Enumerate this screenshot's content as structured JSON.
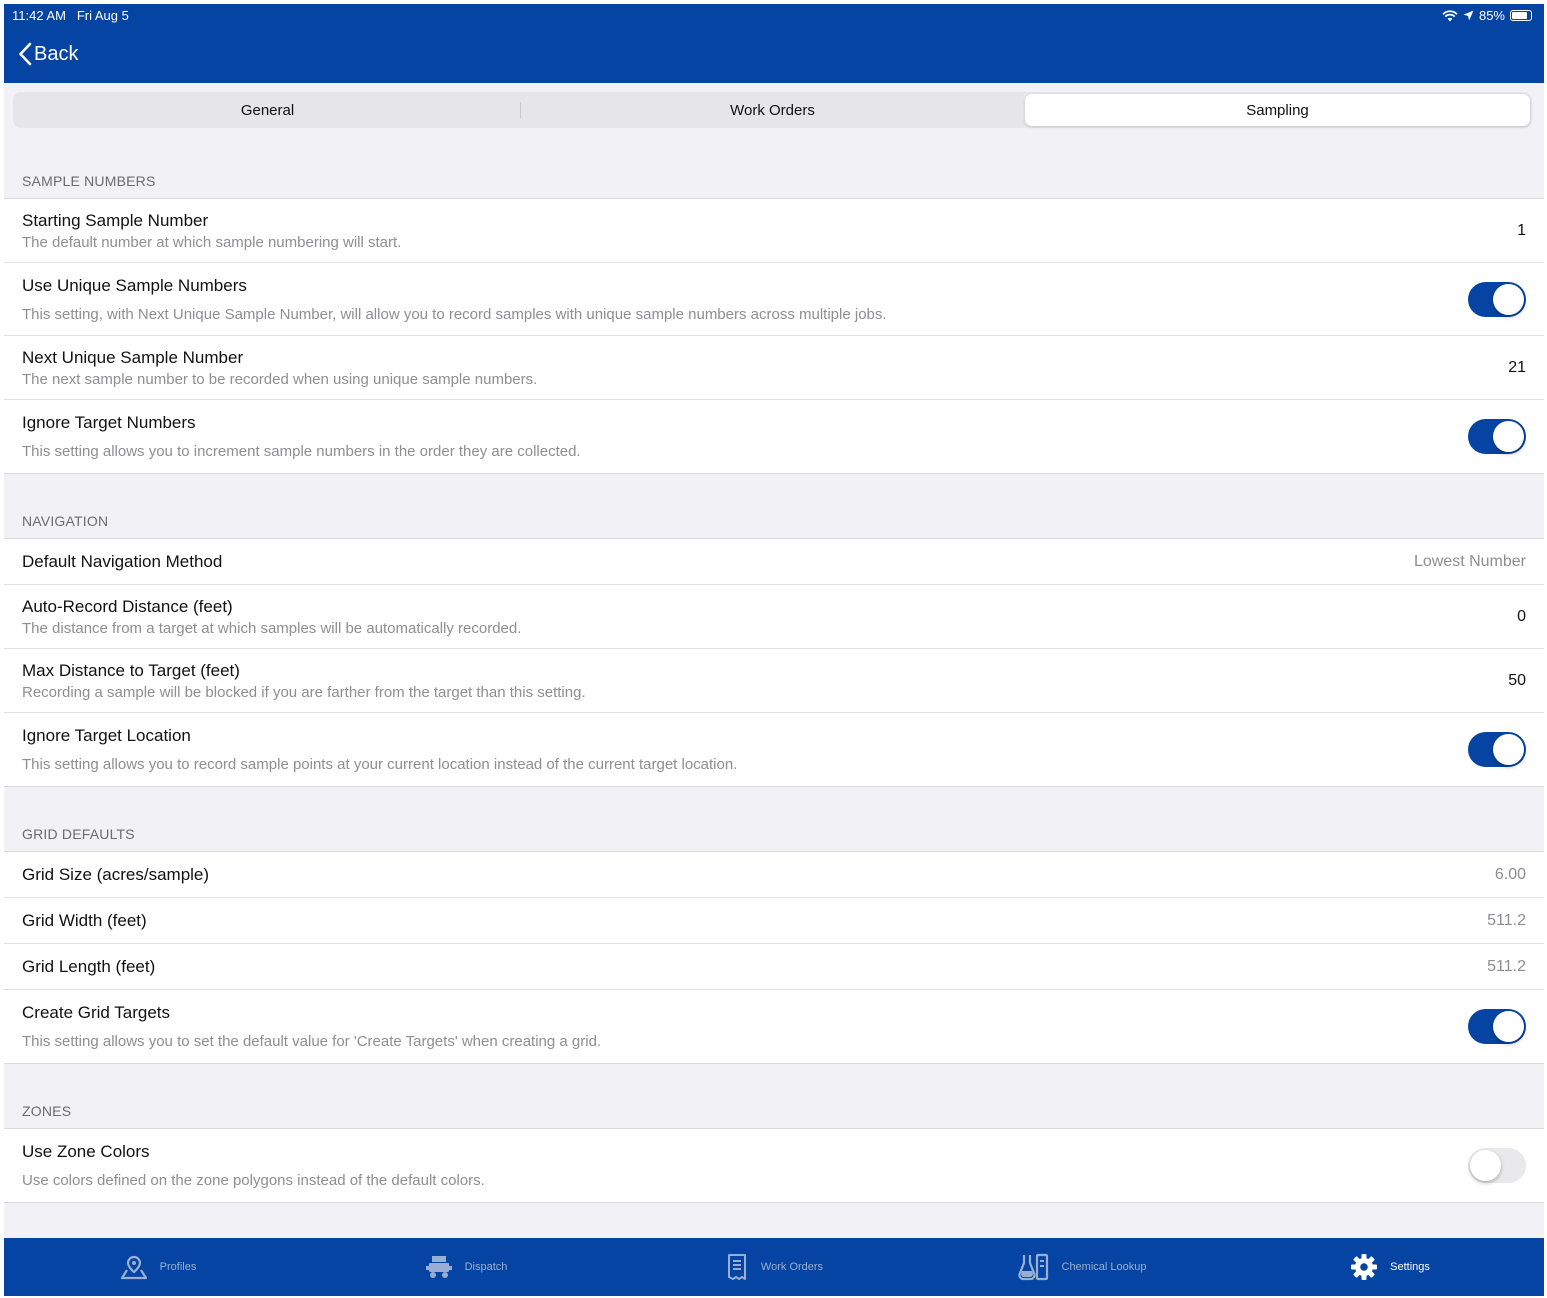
{
  "status_bar": {
    "time": "11:42 AM",
    "date": "Fri Aug 5",
    "battery": "85%"
  },
  "nav": {
    "back_label": "Back"
  },
  "segments": [
    {
      "label": "General",
      "active": false
    },
    {
      "label": "Work Orders",
      "active": false
    },
    {
      "label": "Sampling",
      "active": true
    }
  ],
  "sections": {
    "sample_numbers": {
      "header": "SAMPLE NUMBERS",
      "starting": {
        "title": "Starting Sample Number",
        "desc": "The default number at which sample numbering will start.",
        "value": "1"
      },
      "use_unique": {
        "title": "Use Unique Sample Numbers",
        "desc": "This setting, with Next Unique Sample Number, will allow you to record samples with unique sample numbers across multiple jobs.",
        "on": true
      },
      "next_unique": {
        "title": "Next Unique Sample Number",
        "desc": "The next sample number to be recorded when using unique sample numbers.",
        "value": "21"
      },
      "ignore_target_numbers": {
        "title": "Ignore Target Numbers",
        "desc": "This setting allows you to increment sample numbers in the order they are collected.",
        "on": true
      }
    },
    "navigation": {
      "header": "NAVIGATION",
      "default_method": {
        "title": "Default Navigation Method",
        "value": "Lowest Number"
      },
      "auto_record": {
        "title": "Auto-Record Distance (feet)",
        "desc": "The distance from a target at which samples will be automatically recorded.",
        "value": "0"
      },
      "max_distance": {
        "title": "Max Distance to Target (feet)",
        "desc": "Recording a sample will be blocked if you are farther from the target than this setting.",
        "value": "50"
      },
      "ignore_target_location": {
        "title": "Ignore Target Location",
        "desc": "This setting allows you to record sample points at your current location instead of the current target location.",
        "on": true
      }
    },
    "grid_defaults": {
      "header": "GRID DEFAULTS",
      "grid_size": {
        "title": "Grid Size (acres/sample)",
        "value": "6.00"
      },
      "grid_width": {
        "title": "Grid Width (feet)",
        "value": "511.2"
      },
      "grid_length": {
        "title": "Grid Length (feet)",
        "value": "511.2"
      },
      "create_targets": {
        "title": "Create Grid Targets",
        "desc": "This setting allows you to set the default value for 'Create Targets' when creating a grid.",
        "on": true
      }
    },
    "zones": {
      "header": "ZONES",
      "use_zone_colors": {
        "title": "Use Zone Colors",
        "desc": "Use colors defined on the zone polygons instead of the default colors.",
        "on": false
      }
    }
  },
  "tabbar": {
    "profiles": {
      "label": "Profiles",
      "icon": "profiles-map-pin-icon"
    },
    "dispatch": {
      "label": "Dispatch",
      "icon": "dispatch-truck-icon"
    },
    "work_orders": {
      "label": "Work Orders",
      "icon": "work-orders-document-icon"
    },
    "chemical_lookup": {
      "label": "Chemical Lookup",
      "icon": "chemical-flask-icon"
    },
    "settings": {
      "label": "Settings",
      "icon": "gear-icon",
      "active": true
    }
  },
  "colors": {
    "brand_blue": "#0544a2",
    "group_bg": "#f1f1f6",
    "toggle_off": "#e9e9eb"
  }
}
